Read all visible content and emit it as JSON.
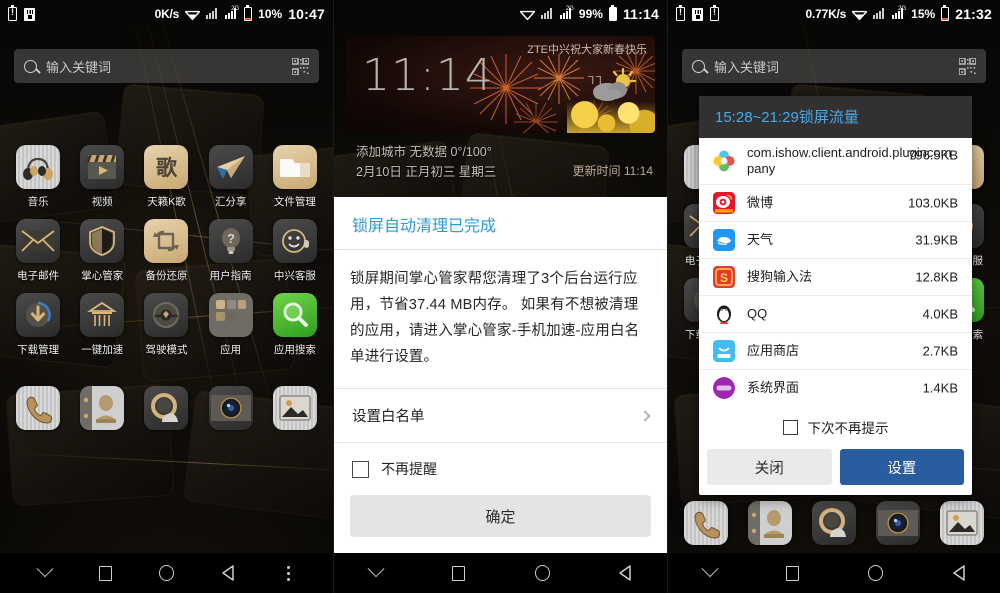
{
  "panels": [
    {
      "id": "home-screen",
      "statusbar": {
        "left_icons": [
          "battery-alert-icon",
          "sdcard-icon"
        ],
        "netspeed": "0K/s",
        "wifi": "wifi-icon",
        "signal1": "signal-icon",
        "signal2": "signal-2g-icon",
        "signal2_tag": "2G",
        "battery_pct": "10%",
        "clock": "10:47"
      },
      "search": {
        "placeholder": "输入关键词",
        "icon": "search-icon",
        "qr": "qr-scan-icon"
      },
      "rows": [
        [
          {
            "label": "音乐",
            "icon": "music-icon",
            "style": "ic-silver"
          },
          {
            "label": "视频",
            "icon": "video-icon",
            "style": "ic-dark"
          },
          {
            "label": "天籁K歌",
            "icon": "karaoke-icon",
            "style": "ic-gold"
          },
          {
            "label": "汇分享",
            "icon": "share-icon",
            "style": "ic-dark"
          },
          {
            "label": "文件管理",
            "icon": "file-manager-icon",
            "style": "ic-gold"
          }
        ],
        [
          {
            "label": "电子邮件",
            "icon": "email-icon",
            "style": "ic-dark"
          },
          {
            "label": "掌心管家",
            "icon": "shield-icon",
            "style": "ic-dark"
          },
          {
            "label": "备份还原",
            "icon": "backup-restore-icon",
            "style": "ic-gold"
          },
          {
            "label": "用户指南",
            "icon": "user-guide-icon",
            "style": "ic-dark"
          },
          {
            "label": "中兴客服",
            "icon": "customer-service-icon",
            "style": "ic-dark"
          }
        ],
        [
          {
            "label": "下载管理",
            "icon": "download-manager-icon",
            "style": "ic-dark"
          },
          {
            "label": "一键加速",
            "icon": "one-tap-boost-icon",
            "style": "ic-dark"
          },
          {
            "label": "驾驶模式",
            "icon": "driving-mode-icon",
            "style": "ic-dark"
          },
          {
            "label": "应用",
            "icon": "app-folder-icon",
            "style": "ic-dark"
          },
          {
            "label": "应用搜索",
            "icon": "app-search-icon",
            "style": "ic-green"
          }
        ]
      ],
      "page_dots": {
        "count": 3,
        "active": 1
      },
      "dock": [
        {
          "label": "电话",
          "icon": "phone-icon",
          "style": "ic-silver"
        },
        {
          "label": "联系人",
          "icon": "contacts-icon",
          "style": "ic-plain"
        },
        {
          "label": "信息",
          "icon": "messages-icon",
          "style": "ic-dark"
        },
        {
          "label": "相机",
          "icon": "camera-icon",
          "style": "ic-dark"
        },
        {
          "label": "图库",
          "icon": "gallery-icon",
          "style": "ic-silver"
        }
      ],
      "navbar": [
        "chevron-down-icon",
        "recents-icon",
        "home-icon",
        "back-icon",
        "overflow-menu-icon"
      ]
    },
    {
      "id": "lockscreen-clean-dialog",
      "statusbar": {
        "netspeed": "",
        "battery_pct": "99%",
        "clock": "11:14",
        "signal2_tag": "2G"
      },
      "widget": {
        "time": "11:14",
        "greeting": "ZTE中兴祝大家新春快乐",
        "subline1": "添加城市 无数据 0°/100°",
        "subline2": "2月10日 正月初三 星期三",
        "degree": "ᒣᒣ",
        "updated": "更新时间 11:14"
      },
      "dialog": {
        "title": "锁屏自动清理已完成",
        "body": "锁屏期间掌心管家帮您清理了3个后台运行应用，节省37.44 MB内存。 如果有不想被清理的应用，请进入掌心管家-手机加速-应用白名单进行设置。",
        "whitelist_row": "设置白名单",
        "checkbox_label": "不再提醒",
        "confirm_label": "确定"
      },
      "navbar": [
        "chevron-down-icon",
        "recents-icon",
        "home-icon",
        "back-icon"
      ]
    },
    {
      "id": "lockscreen-traffic-dialog",
      "statusbar": {
        "left_icons": [
          "battery-alert-icon",
          "sdcard-icon",
          "battery-alert-icon"
        ],
        "netspeed": "0.77K/s",
        "battery_pct": "15%",
        "clock": "21:32",
        "signal2_tag": "2G"
      },
      "search": {
        "placeholder": "输入关键词"
      },
      "dialog": {
        "title": "15:28~21:29锁屏流量",
        "items": [
          {
            "name": "com.ishow.client.android.plugincompany",
            "size": "796.5KB",
            "icon": "ishow-clover-icon",
            "wrapped": true
          },
          {
            "name": "微博",
            "size": "103.0KB",
            "icon": "weibo-icon"
          },
          {
            "name": "天气",
            "size": "31.9KB",
            "icon": "weather-icon"
          },
          {
            "name": "搜狗输入法",
            "size": "12.8KB",
            "icon": "sogou-ime-icon"
          },
          {
            "name": "QQ",
            "size": "4.0KB",
            "icon": "qq-icon"
          },
          {
            "name": "应用商店",
            "size": "2.7KB",
            "icon": "app-store-icon"
          },
          {
            "name": "系统界面",
            "size": "1.4KB",
            "icon": "system-ui-icon"
          }
        ],
        "checkbox_label": "下次不再提示",
        "close_label": "关闭",
        "settings_label": "设置"
      },
      "navbar": [
        "chevron-down-icon",
        "recents-icon",
        "home-icon",
        "back-icon"
      ]
    }
  ],
  "colors": {
    "accent_blue": "#2c9bd6",
    "dialog_title_blue": "#4aa8e8",
    "primary_button": "#2a5ca0",
    "battery_low": "#f05a23",
    "green_icon": "#2f9e1e"
  }
}
